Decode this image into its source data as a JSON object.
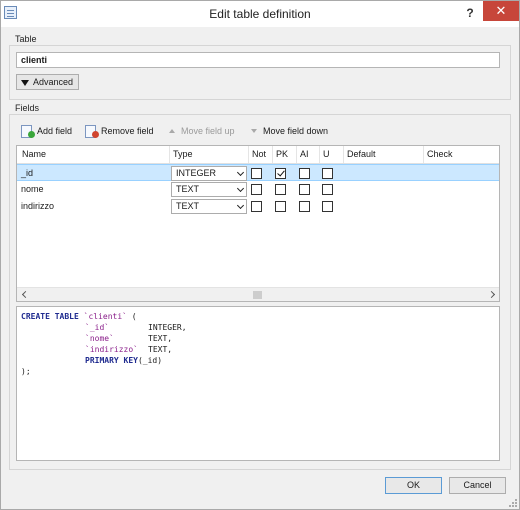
{
  "window": {
    "title": "Edit table definition",
    "help_glyph": "?",
    "close_glyph": "✕"
  },
  "table_section": {
    "label": "Table",
    "name_value": "clienti",
    "advanced_label": "Advanced"
  },
  "fields_section": {
    "label": "Fields",
    "toolbar": {
      "add": "Add field",
      "remove": "Remove field",
      "up": "Move field up",
      "down": "Move field down"
    },
    "columns": [
      "Name",
      "Type",
      "Not",
      "PK",
      "AI",
      "U",
      "Default",
      "Check"
    ],
    "rows": [
      {
        "name": "_id",
        "type": "INTEGER",
        "not_null": false,
        "pk": true,
        "ai": false,
        "unique": false,
        "selected": true
      },
      {
        "name": "nome",
        "type": "TEXT",
        "not_null": false,
        "pk": false,
        "ai": false,
        "unique": false,
        "selected": false
      },
      {
        "name": "indirizzo",
        "type": "TEXT",
        "not_null": false,
        "pk": false,
        "ai": false,
        "unique": false,
        "selected": false
      }
    ]
  },
  "sql": {
    "create_kw": "CREATE TABLE",
    "table_ident": "`clienti`",
    "open": " (",
    "col_defs": [
      {
        "ident": "`_id`",
        "type": "INTEGER,"
      },
      {
        "ident": "`nome`",
        "type": "TEXT,"
      },
      {
        "ident": "`indirizzo`",
        "type": "TEXT,"
      }
    ],
    "pk_kw": "PRIMARY KEY",
    "pk_arg": "(_id)",
    "close": ");"
  },
  "buttons": {
    "ok": "OK",
    "cancel": "Cancel"
  }
}
